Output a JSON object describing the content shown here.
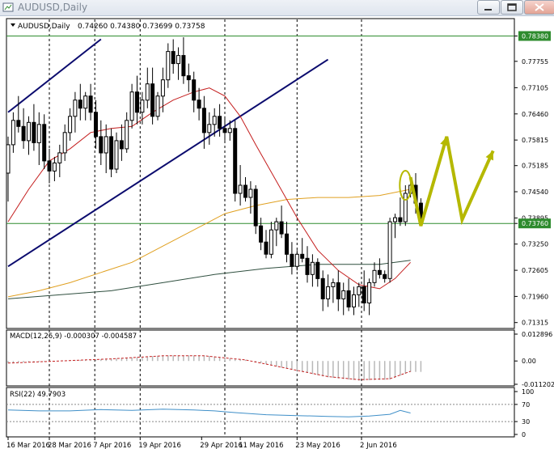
{
  "window": {
    "title": "AUDUSD,Daily",
    "buttons": [
      "minimize-icon",
      "restore-icon",
      "close-icon"
    ]
  },
  "colors": {
    "bullish_candle": "#ffffff",
    "bearish_candle": "#000000",
    "ma_fast": "#c41e1e",
    "ma_mid": "#e0a020",
    "ma_slow": "#2f4f3f",
    "channel": "#0b0b6e",
    "horizontal_lines": "#2e8b2e",
    "projection": "#b5b800",
    "macd_histogram": "#b8b8b8",
    "macd_signal": "#c41e1e",
    "rsi": "#3f8fc8",
    "price_box_bg": "#2e8b2e"
  },
  "chart_data": {
    "type": "candlestick",
    "symbol": "AUDUSD",
    "timeframe": "Daily",
    "header": {
      "symbol_label": "AUDUSD,Daily",
      "ohlc": "0.74260 0.74380 0.73699 0.73758"
    },
    "price_axis_ticks": [
      "0.78380",
      "0.77755",
      "0.77105",
      "0.76460",
      "0.75815",
      "0.75185",
      "0.74540",
      "0.73895",
      "0.73760",
      "0.73250",
      "0.72605",
      "0.71960",
      "0.71315"
    ],
    "date_labels": [
      "16 Mar 2016",
      "28 Mar 2016",
      "7 Apr 2016",
      "19 Apr 2016",
      "29 Apr 2016",
      "11 May 2016",
      "23 May 2016",
      "2 Jun 2016"
    ],
    "horizontal_levels": [
      {
        "price": 0.7838,
        "label": "0.78380"
      },
      {
        "price": 0.7376,
        "label": "0.73760"
      }
    ],
    "candles": [
      [
        0.75,
        0.759,
        0.743,
        0.757
      ],
      [
        0.757,
        0.765,
        0.755,
        0.763
      ],
      [
        0.763,
        0.769,
        0.76,
        0.7615
      ],
      [
        0.7615,
        0.766,
        0.756,
        0.758
      ],
      [
        0.758,
        0.764,
        0.7545,
        0.7625
      ],
      [
        0.7625,
        0.767,
        0.7555,
        0.7575
      ],
      [
        0.7575,
        0.765,
        0.752,
        0.762
      ],
      [
        0.762,
        0.7645,
        0.751,
        0.753
      ],
      [
        0.753,
        0.756,
        0.7475,
        0.7505
      ],
      [
        0.7505,
        0.754,
        0.748,
        0.7525
      ],
      [
        0.7525,
        0.757,
        0.749,
        0.755
      ],
      [
        0.755,
        0.762,
        0.753,
        0.76
      ],
      [
        0.76,
        0.766,
        0.758,
        0.764
      ],
      [
        0.764,
        0.77,
        0.76,
        0.768
      ],
      [
        0.768,
        0.772,
        0.763,
        0.766
      ],
      [
        0.766,
        0.77,
        0.763,
        0.769
      ],
      [
        0.769,
        0.772,
        0.763,
        0.765
      ],
      [
        0.765,
        0.768,
        0.756,
        0.759
      ],
      [
        0.759,
        0.763,
        0.752,
        0.755
      ],
      [
        0.755,
        0.762,
        0.75,
        0.759
      ],
      [
        0.759,
        0.761,
        0.749,
        0.751
      ],
      [
        0.751,
        0.76,
        0.75,
        0.758
      ],
      [
        0.758,
        0.762,
        0.753,
        0.756
      ],
      [
        0.756,
        0.765,
        0.755,
        0.763
      ],
      [
        0.763,
        0.772,
        0.761,
        0.77
      ],
      [
        0.77,
        0.774,
        0.762,
        0.765
      ],
      [
        0.765,
        0.77,
        0.762,
        0.768
      ],
      [
        0.768,
        0.776,
        0.766,
        0.772
      ],
      [
        0.772,
        0.776,
        0.762,
        0.764
      ],
      [
        0.764,
        0.77,
        0.763,
        0.769
      ],
      [
        0.769,
        0.776,
        0.765,
        0.773
      ],
      [
        0.773,
        0.782,
        0.771,
        0.78
      ],
      [
        0.78,
        0.783,
        0.7745,
        0.777
      ],
      [
        0.777,
        0.781,
        0.773,
        0.779
      ],
      [
        0.779,
        0.7835,
        0.772,
        0.774
      ],
      [
        0.774,
        0.777,
        0.77,
        0.773
      ],
      [
        0.773,
        0.775,
        0.765,
        0.768
      ],
      [
        0.768,
        0.771,
        0.763,
        0.766
      ],
      [
        0.766,
        0.769,
        0.756,
        0.76
      ],
      [
        0.76,
        0.765,
        0.757,
        0.762
      ],
      [
        0.762,
        0.766,
        0.759,
        0.764
      ],
      [
        0.764,
        0.767,
        0.759,
        0.761
      ],
      [
        0.761,
        0.764,
        0.758,
        0.76
      ],
      [
        0.76,
        0.763,
        0.758,
        0.761
      ],
      [
        0.761,
        0.763,
        0.743,
        0.745
      ],
      [
        0.745,
        0.752,
        0.742,
        0.747
      ],
      [
        0.747,
        0.749,
        0.743,
        0.744
      ],
      [
        0.744,
        0.748,
        0.74,
        0.746
      ],
      [
        0.746,
        0.747,
        0.735,
        0.737
      ],
      [
        0.737,
        0.739,
        0.731,
        0.733
      ],
      [
        0.733,
        0.736,
        0.729,
        0.73
      ],
      [
        0.73,
        0.738,
        0.729,
        0.736
      ],
      [
        0.736,
        0.739,
        0.732,
        0.738
      ],
      [
        0.738,
        0.742,
        0.734,
        0.735
      ],
      [
        0.735,
        0.738,
        0.728,
        0.73
      ],
      [
        0.73,
        0.733,
        0.725,
        0.727
      ],
      [
        0.727,
        0.731,
        0.726,
        0.73
      ],
      [
        0.73,
        0.734,
        0.728,
        0.729
      ],
      [
        0.729,
        0.732,
        0.723,
        0.725
      ],
      [
        0.725,
        0.73,
        0.722,
        0.728
      ],
      [
        0.728,
        0.729,
        0.722,
        0.724
      ],
      [
        0.724,
        0.726,
        0.716,
        0.719
      ],
      [
        0.719,
        0.725,
        0.717,
        0.722
      ],
      [
        0.722,
        0.724,
        0.718,
        0.723
      ],
      [
        0.723,
        0.726,
        0.716,
        0.719
      ],
      [
        0.719,
        0.723,
        0.715,
        0.721
      ],
      [
        0.721,
        0.724,
        0.716,
        0.717
      ],
      [
        0.717,
        0.722,
        0.715,
        0.72
      ],
      [
        0.72,
        0.723,
        0.717,
        0.722
      ],
      [
        0.722,
        0.726,
        0.716,
        0.718
      ],
      [
        0.718,
        0.724,
        0.715,
        0.723
      ],
      [
        0.723,
        0.728,
        0.722,
        0.726
      ],
      [
        0.726,
        0.729,
        0.724,
        0.725
      ],
      [
        0.725,
        0.726,
        0.723,
        0.724
      ],
      [
        0.724,
        0.739,
        0.723,
        0.738
      ],
      [
        0.738,
        0.74,
        0.734,
        0.739
      ],
      [
        0.739,
        0.744,
        0.737,
        0.738
      ],
      [
        0.738,
        0.747,
        0.737,
        0.745
      ],
      [
        0.745,
        0.748,
        0.744,
        0.747
      ],
      [
        0.747,
        0.75,
        0.74,
        0.7426
      ],
      [
        0.7426,
        0.7438,
        0.737,
        0.7376
      ]
    ],
    "ma_fast": [
      [
        0,
        0.738
      ],
      [
        4,
        0.746
      ],
      [
        8,
        0.753
      ],
      [
        12,
        0.756
      ],
      [
        16,
        0.76
      ],
      [
        20,
        0.761
      ],
      [
        24,
        0.7615
      ],
      [
        28,
        0.765
      ],
      [
        32,
        0.768
      ],
      [
        36,
        0.77
      ],
      [
        39,
        0.771
      ],
      [
        42,
        0.769
      ],
      [
        45,
        0.764
      ],
      [
        48,
        0.757
      ],
      [
        52,
        0.748
      ],
      [
        56,
        0.739
      ],
      [
        60,
        0.731
      ],
      [
        64,
        0.726
      ],
      [
        68,
        0.7225
      ],
      [
        72,
        0.7215
      ],
      [
        75,
        0.724
      ],
      [
        78,
        0.728
      ]
    ],
    "ma_mid": [
      [
        0,
        0.7195
      ],
      [
        6,
        0.721
      ],
      [
        12,
        0.723
      ],
      [
        18,
        0.7255
      ],
      [
        24,
        0.728
      ],
      [
        30,
        0.732
      ],
      [
        36,
        0.736
      ],
      [
        42,
        0.74
      ],
      [
        48,
        0.742
      ],
      [
        54,
        0.7435
      ],
      [
        60,
        0.744
      ],
      [
        66,
        0.744
      ],
      [
        72,
        0.7445
      ],
      [
        78,
        0.746
      ]
    ],
    "ma_slow": [
      [
        0,
        0.719
      ],
      [
        10,
        0.72
      ],
      [
        20,
        0.721
      ],
      [
        30,
        0.723
      ],
      [
        40,
        0.725
      ],
      [
        50,
        0.7265
      ],
      [
        60,
        0.7275
      ],
      [
        66,
        0.7275
      ],
      [
        72,
        0.7275
      ],
      [
        78,
        0.7285
      ]
    ],
    "channel_lines": [
      {
        "from": [
          0,
          0.765
        ],
        "to": [
          18,
          0.783
        ]
      },
      {
        "from": [
          0,
          0.727
        ],
        "to": [
          62,
          0.778
        ]
      }
    ],
    "projection_path": [
      [
        78,
        0.749
      ],
      [
        80,
        0.737
      ],
      [
        85,
        0.759
      ],
      [
        88,
        0.7385
      ],
      [
        94,
        0.7555
      ]
    ],
    "highlight_ellipse_at": [
      77,
      0.747
    ],
    "macd": {
      "label": "MACD(12,26,9) -0.000307 -0.004587",
      "ticks": [
        "0.012896",
        "0.00",
        "-0.011202"
      ],
      "range": [
        -0.0112,
        0.0129
      ],
      "signal": [
        [
          0,
          -0.001
        ],
        [
          10,
          0.0
        ],
        [
          20,
          0.001
        ],
        [
          30,
          0.0025
        ],
        [
          38,
          0.0025
        ],
        [
          46,
          0.0005
        ],
        [
          54,
          -0.0035
        ],
        [
          62,
          -0.0075
        ],
        [
          68,
          -0.009
        ],
        [
          74,
          -0.0085
        ],
        [
          78,
          -0.005
        ]
      ]
    },
    "rsi": {
      "label": "RSI(22) 49.7903",
      "ticks": [
        "100",
        "70",
        "30",
        "0"
      ],
      "levels": [
        70,
        30
      ],
      "values": [
        [
          0,
          57
        ],
        [
          6,
          55
        ],
        [
          12,
          55
        ],
        [
          18,
          58
        ],
        [
          24,
          56
        ],
        [
          30,
          59
        ],
        [
          36,
          57
        ],
        [
          40,
          55
        ],
        [
          44,
          51
        ],
        [
          50,
          46
        ],
        [
          56,
          44
        ],
        [
          62,
          42
        ],
        [
          66,
          41
        ],
        [
          70,
          43
        ],
        [
          74,
          47
        ],
        [
          76,
          56
        ],
        [
          78,
          50
        ]
      ]
    }
  }
}
